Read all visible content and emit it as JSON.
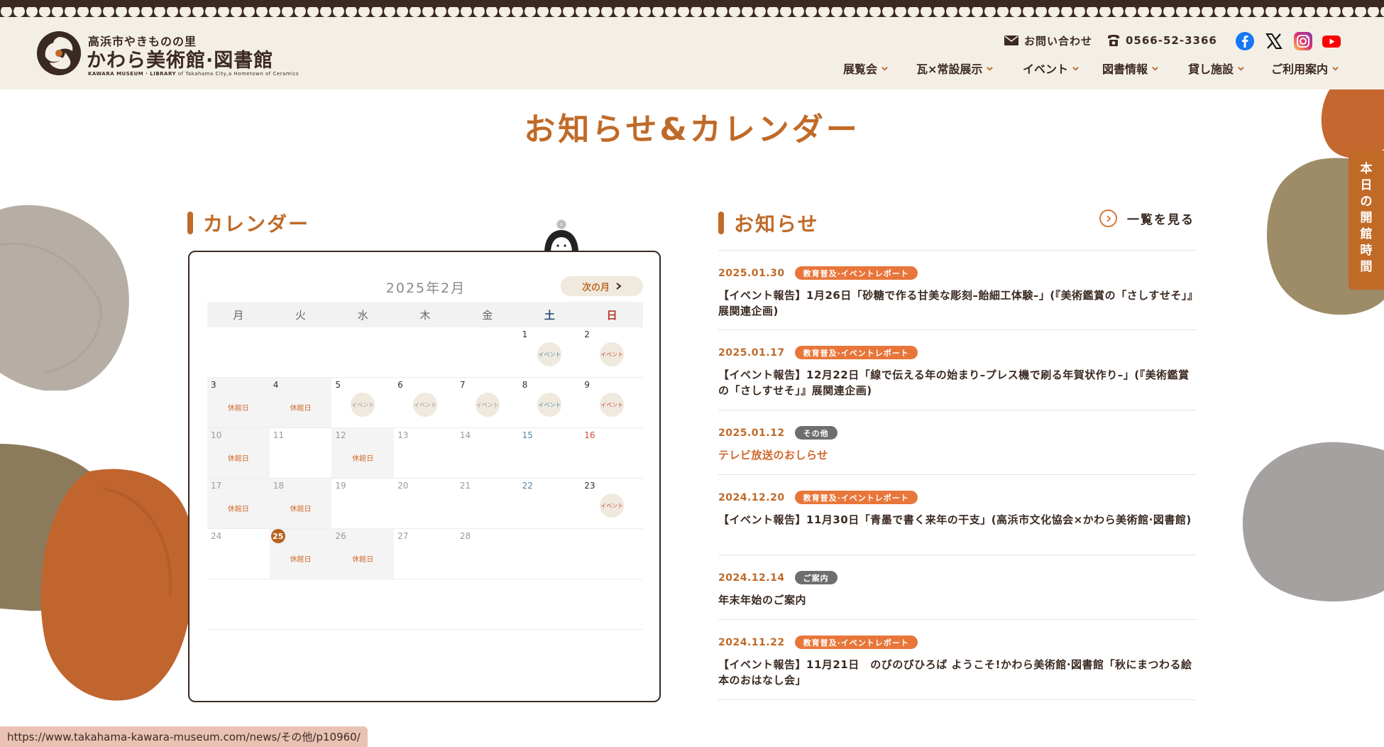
{
  "site": {
    "logo_sub": "高浜市やきものの里",
    "logo_main": "かわら美術館·図書館",
    "logo_en_strong": "KAWARA MUSEUM · LIBRARY",
    "logo_en_rest": "of Takahama City,a Hometown of Ceramics"
  },
  "utility": {
    "contact_label": "お問い合わせ",
    "phone": "0566-52-3366",
    "social": [
      {
        "icon": "facebook-icon",
        "color": "#1877f2"
      },
      {
        "icon": "x-icon",
        "color": "#111111"
      },
      {
        "icon": "instagram-icon",
        "color": "#d6249f"
      },
      {
        "icon": "youtube-icon",
        "color": "#ff0000"
      }
    ]
  },
  "nav": [
    {
      "label": "展覧会"
    },
    {
      "label": "瓦×常設展示"
    },
    {
      "label": "イベント"
    },
    {
      "label": "図書情報"
    },
    {
      "label": "貸し施設"
    },
    {
      "label": "ご利用案内"
    }
  ],
  "page_title": "お知らせ&カレンダー",
  "calendar": {
    "heading": "カレンダー",
    "month": "2025年2月",
    "next_label": "次の月",
    "weekdays": [
      "月",
      "火",
      "水",
      "木",
      "金",
      "土",
      "日"
    ],
    "closed_label": "休館日",
    "event_label": "イベント",
    "weeks": [
      [
        null,
        null,
        null,
        null,
        null,
        {
          "d": "1",
          "ev": true
        },
        {
          "d": "2",
          "ev": true
        }
      ],
      [
        {
          "d": "3",
          "closed": true
        },
        {
          "d": "4",
          "closed": true
        },
        {
          "d": "5",
          "ev": true
        },
        {
          "d": "6",
          "ev": true
        },
        {
          "d": "7",
          "ev": true
        },
        {
          "d": "8",
          "ev": true
        },
        {
          "d": "9",
          "ev": true
        }
      ],
      [
        {
          "d": "10",
          "closed": true,
          "past": true
        },
        {
          "d": "11",
          "past": true
        },
        {
          "d": "12",
          "closed": true,
          "past": true
        },
        {
          "d": "13",
          "past": true
        },
        {
          "d": "14",
          "past": true
        },
        {
          "d": "15",
          "past": true
        },
        {
          "d": "16",
          "past": true
        }
      ],
      [
        {
          "d": "17",
          "closed": true,
          "past": true
        },
        {
          "d": "18",
          "closed": true,
          "past": true
        },
        {
          "d": "19",
          "past": true
        },
        {
          "d": "20",
          "past": true
        },
        {
          "d": "21",
          "past": true
        },
        {
          "d": "22",
          "past": true
        },
        {
          "d": "23",
          "ev": true
        }
      ],
      [
        {
          "d": "24",
          "past": true
        },
        {
          "d": "25",
          "closed": true,
          "today": true
        },
        {
          "d": "26",
          "closed": true,
          "past": true
        },
        {
          "d": "27",
          "past": true
        },
        {
          "d": "28",
          "past": true
        },
        null,
        null
      ],
      [
        null,
        null,
        null,
        null,
        null,
        null,
        null
      ]
    ]
  },
  "news": {
    "heading": "お知らせ",
    "more_label": "一覧を見る",
    "items": [
      {
        "date": "2025.01.30",
        "tag": "教育普及·イベントレポート",
        "tag_color": "orange",
        "title": "【イベント報告】1月26日「砂糖で作る甘美な彫刻–飴細工体験–」(『美術鑑賞の「さしすせそ」』展関連企画)",
        "h": 112
      },
      {
        "date": "2025.01.17",
        "tag": "教育普及·イベントレポート",
        "tag_color": "orange",
        "title": "【イベント報告】12月22日「線で伝える年の始まり–プレス機で刷る年賀状作り–」(『美術鑑賞の「さしすせそ」』展関連企画)",
        "h": 113
      },
      {
        "date": "2025.01.12",
        "tag": "その他",
        "tag_color": "gray",
        "title": "テレビ放送のおしらせ",
        "link": true,
        "h": 91
      },
      {
        "date": "2024.12.20",
        "tag": "教育普及·イベントレポート",
        "tag_color": "orange",
        "title": "【イベント報告】11月30日「青墨で書く来年の干支」(高浜市文化協会×かわら美術館·図書館)",
        "h": 113
      },
      {
        "date": "2024.12.14",
        "tag": "ご案内",
        "tag_color": "gray",
        "title": "年末年始のご案内",
        "h": 91
      },
      {
        "date": "2024.11.22",
        "tag": "教育普及·イベントレポート",
        "tag_color": "orange",
        "title": "【イベント報告】11月21日　のびのびひろば ようこそ!かわら美術館·図書館「秋にまつわる絵本のおはなし会」",
        "h": 114
      }
    ]
  },
  "side_tab": "本日の開館時間",
  "status_url": "https://www.takahama-kawara-museum.com/news/その他/p10960/",
  "colors": {
    "accent": "#c06a28",
    "dark": "#3b2a22",
    "tag_orange": "#e8763a",
    "tag_gray": "#6e6e6e"
  }
}
